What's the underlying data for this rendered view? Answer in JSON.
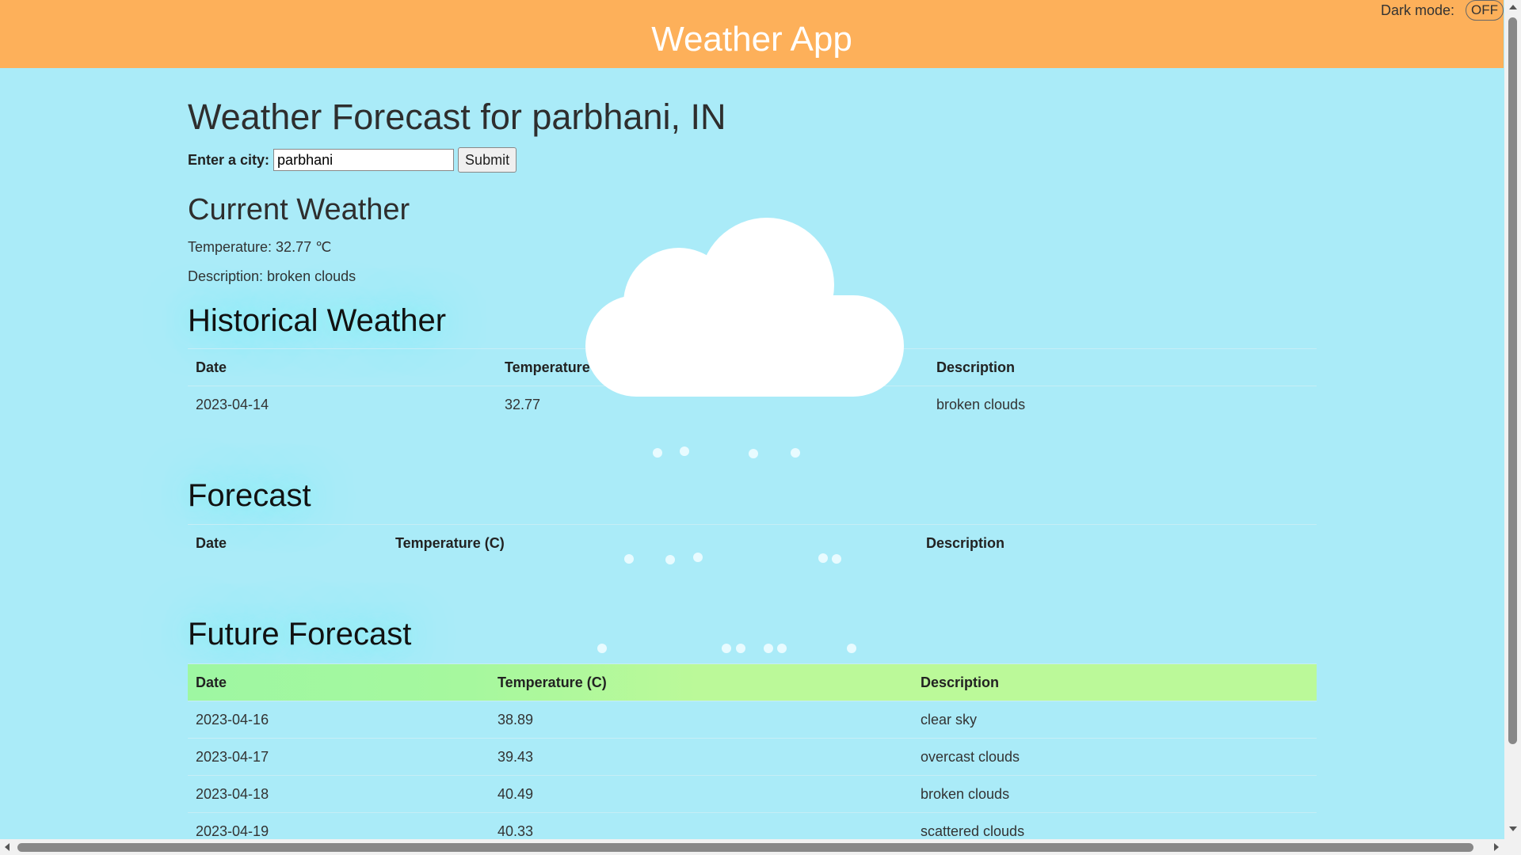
{
  "header": {
    "title": "Weather App",
    "dark_mode_label": "Dark mode:",
    "dark_mode_state": "OFF"
  },
  "page": {
    "title": "Weather Forecast for parbhani, IN"
  },
  "form": {
    "label": "Enter a city:",
    "city_value": "parbhani",
    "submit_label": "Submit"
  },
  "current": {
    "heading": "Current Weather",
    "temperature": "Temperature: 32.77 ℃",
    "description": "Description: broken clouds"
  },
  "historical": {
    "heading": "Historical Weather",
    "columns": [
      "Date",
      "Temperature (C)",
      "Description"
    ],
    "rows": [
      [
        "2023-04-14",
        "32.77",
        "broken clouds"
      ]
    ]
  },
  "forecast": {
    "heading": "Forecast",
    "columns": [
      "Date",
      "Temperature (C)",
      "Description"
    ],
    "rows": []
  },
  "future": {
    "heading": "Future Forecast",
    "columns": [
      "Date",
      "Temperature (C)",
      "Description"
    ],
    "rows": [
      [
        "2023-04-16",
        "38.89",
        "clear sky"
      ],
      [
        "2023-04-17",
        "39.43",
        "overcast clouds"
      ],
      [
        "2023-04-18",
        "40.49",
        "broken clouds"
      ],
      [
        "2023-04-19",
        "40.33",
        "scattered clouds"
      ]
    ]
  },
  "colors": {
    "background": "#aaebf8",
    "header": "#fdb05a",
    "future_header_row": "#bbf999"
  },
  "icons": {
    "weather_animation": "cloud-icon",
    "rain": "raindrop-icon"
  }
}
